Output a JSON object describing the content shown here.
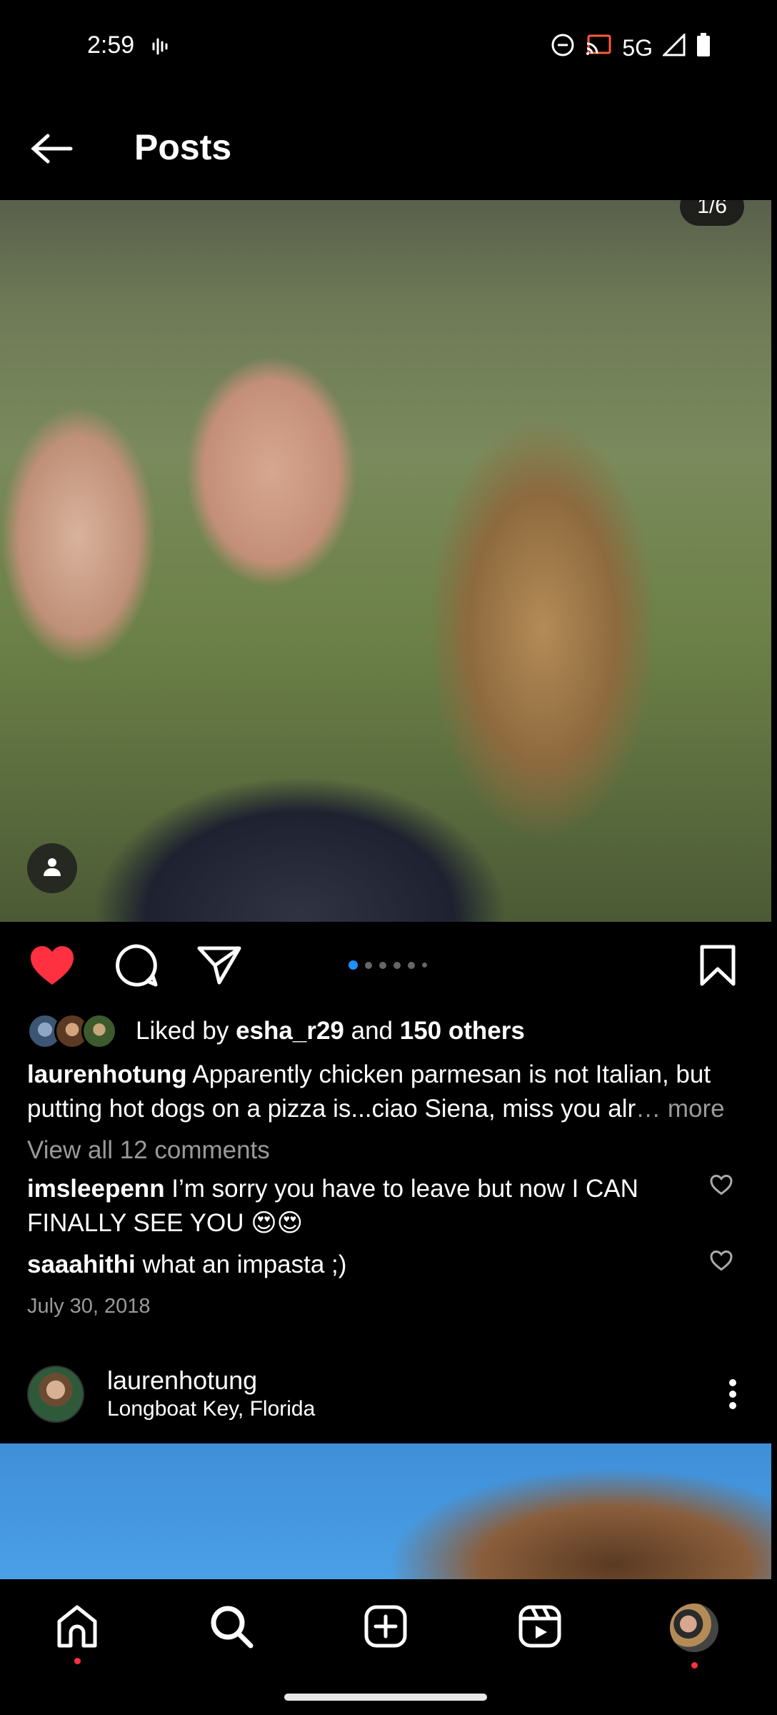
{
  "status": {
    "time": "2:59",
    "network": "5G"
  },
  "header": {
    "title": "Posts"
  },
  "post": {
    "counter": "1/6",
    "carousel": {
      "total": 6,
      "active_index": 0
    },
    "liked": true,
    "likes": {
      "prefix": "Liked by ",
      "user": "esha_r29",
      "middle": " and ",
      "others": "150 others"
    },
    "caption": {
      "username": "laurenhotung",
      "text": " Apparently chicken parmesan is not Italian, but putting hot dogs on a pizza is...ciao Siena, miss you alr",
      "more": "… more"
    },
    "view_comments": "View all 12 comments",
    "comments": [
      {
        "username": "imsleepenn",
        "text": " I’m sorry you have to leave but now I CAN FINALLY SEE YOU 😍😍"
      },
      {
        "username": "saaahithi",
        "text": " what an impasta ;)"
      }
    ],
    "date": "July 30, 2018"
  },
  "next_post": {
    "username": "laurenhotung",
    "location": "Longboat Key, Florida"
  },
  "colors": {
    "like_red": "#ff3040",
    "accent_blue": "#1e90ff"
  },
  "icons": {
    "back": "arrow-left-icon",
    "like": "heart-filled-icon",
    "comment": "comment-bubble-icon",
    "share": "paper-plane-icon",
    "save": "bookmark-icon",
    "home": "home-icon",
    "search": "search-icon",
    "create": "plus-square-icon",
    "reels": "reels-icon"
  }
}
